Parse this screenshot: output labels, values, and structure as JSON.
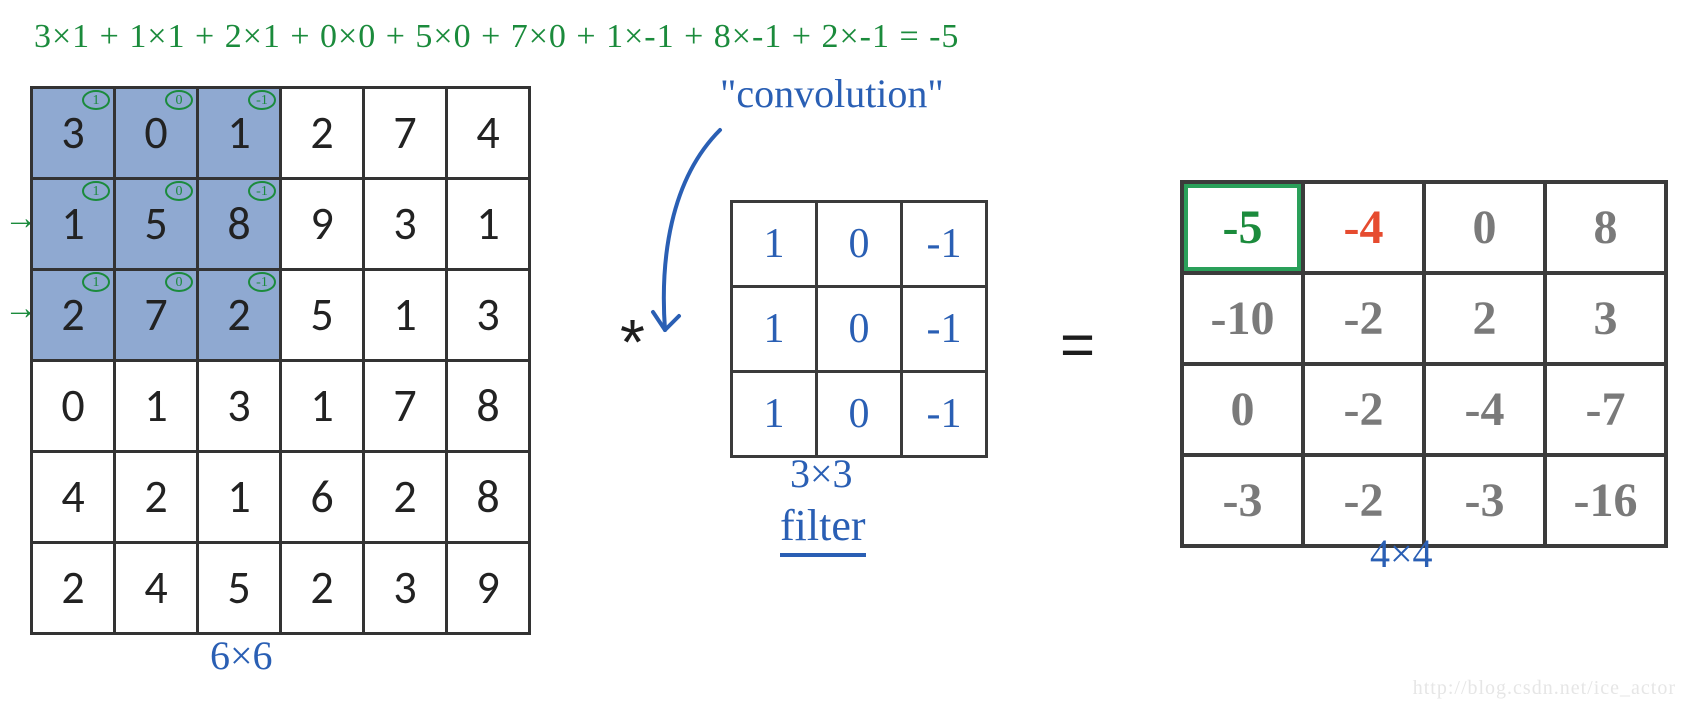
{
  "equation_top": "3×1 + 1×1 + 2×1 + 0×0 + 5×0 + 7×0 + 1×-1 + 8×-1 + 2×-1 = -5",
  "input": {
    "label": "6×6",
    "highlight": {
      "r0": 0,
      "r1": 2,
      "c0": 0,
      "c1": 2
    },
    "cells": [
      [
        "3",
        "0",
        "1",
        "2",
        "7",
        "4"
      ],
      [
        "1",
        "5",
        "8",
        "9",
        "3",
        "1"
      ],
      [
        "2",
        "7",
        "2",
        "5",
        "1",
        "3"
      ],
      [
        "0",
        "1",
        "3",
        "1",
        "7",
        "8"
      ],
      [
        "4",
        "2",
        "1",
        "6",
        "2",
        "8"
      ],
      [
        "2",
        "4",
        "5",
        "2",
        "3",
        "9"
      ]
    ],
    "sup": [
      [
        "1",
        "0",
        "-1"
      ],
      [
        "1",
        "0",
        "-1"
      ],
      [
        "1",
        "0",
        "-1"
      ]
    ]
  },
  "operator_star": "*",
  "conv_label": "\"convolution\"",
  "filter": {
    "size_label": "3×3",
    "name_label": "filter",
    "cells": [
      [
        "1",
        "0",
        "-1"
      ],
      [
        "1",
        "0",
        "-1"
      ],
      [
        "1",
        "0",
        "-1"
      ]
    ]
  },
  "equals": "=",
  "output": {
    "label": "4×4",
    "cells": [
      [
        "-5",
        "-4",
        "0",
        "8"
      ],
      [
        "-10",
        "-2",
        "2",
        "3"
      ],
      [
        "0",
        "-2",
        "-4",
        "-7"
      ],
      [
        "-3",
        "-2",
        "-3",
        "-16"
      ]
    ],
    "styles": [
      [
        "green-box green-text",
        "red-text",
        "",
        ""
      ],
      [
        "",
        "",
        "",
        ""
      ],
      [
        "",
        "",
        "",
        ""
      ],
      [
        "",
        "",
        "",
        ""
      ]
    ]
  },
  "watermark": "http://blog.csdn.net/ice_actor"
}
